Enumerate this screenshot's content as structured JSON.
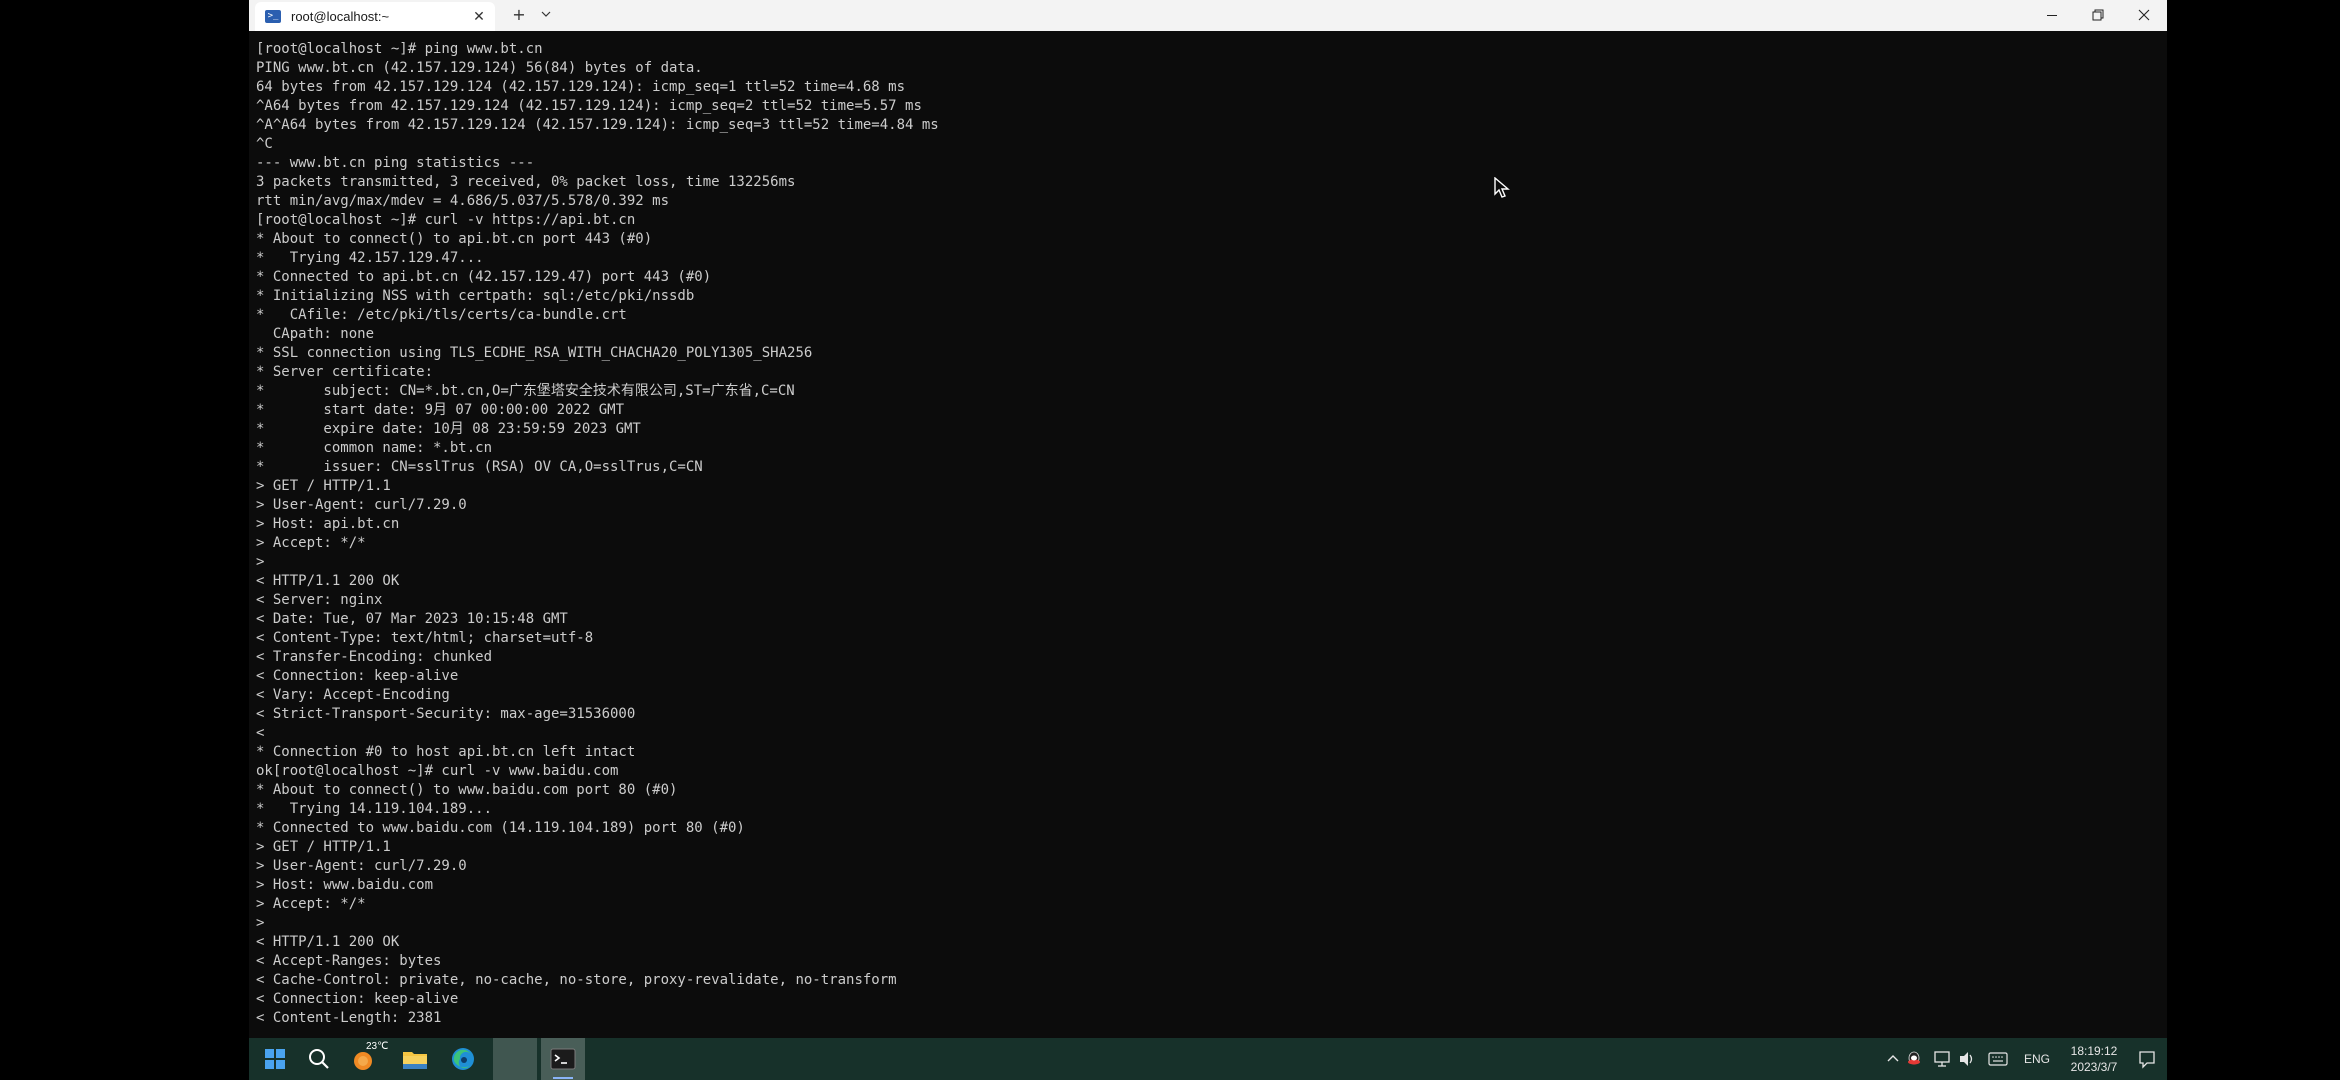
{
  "window": {
    "tab_title": "root@localhost:~",
    "tab_icon": "terminal-icon",
    "close_tab_glyph": "✕",
    "new_tab_glyph": "+",
    "dropdown_glyph": "⌄"
  },
  "terminal": {
    "lines": [
      "[root@localhost ~]# ping www.bt.cn",
      "PING www.bt.cn (42.157.129.124) 56(84) bytes of data.",
      "64 bytes from 42.157.129.124 (42.157.129.124): icmp_seq=1 ttl=52 time=4.68 ms",
      "^A64 bytes from 42.157.129.124 (42.157.129.124): icmp_seq=2 ttl=52 time=5.57 ms",
      "^A^A64 bytes from 42.157.129.124 (42.157.129.124): icmp_seq=3 ttl=52 time=4.84 ms",
      "^C",
      "--- www.bt.cn ping statistics ---",
      "3 packets transmitted, 3 received, 0% packet loss, time 132256ms",
      "rtt min/avg/max/mdev = 4.686/5.037/5.578/0.392 ms",
      "[root@localhost ~]# curl -v https://api.bt.cn",
      "* About to connect() to api.bt.cn port 443 (#0)",
      "*   Trying 42.157.129.47...",
      "* Connected to api.bt.cn (42.157.129.47) port 443 (#0)",
      "* Initializing NSS with certpath: sql:/etc/pki/nssdb",
      "*   CAfile: /etc/pki/tls/certs/ca-bundle.crt",
      "  CApath: none",
      "* SSL connection using TLS_ECDHE_RSA_WITH_CHACHA20_POLY1305_SHA256",
      "* Server certificate:",
      "*       subject: CN=*.bt.cn,O=广东堡塔安全技术有限公司,ST=广东省,C=CN",
      "*       start date: 9月 07 00:00:00 2022 GMT",
      "*       expire date: 10月 08 23:59:59 2023 GMT",
      "*       common name: *.bt.cn",
      "*       issuer: CN=sslTrus (RSA) OV CA,O=sslTrus,C=CN",
      "> GET / HTTP/1.1",
      "> User-Agent: curl/7.29.0",
      "> Host: api.bt.cn",
      "> Accept: */*",
      ">",
      "< HTTP/1.1 200 OK",
      "< Server: nginx",
      "< Date: Tue, 07 Mar 2023 10:15:48 GMT",
      "< Content-Type: text/html; charset=utf-8",
      "< Transfer-Encoding: chunked",
      "< Connection: keep-alive",
      "< Vary: Accept-Encoding",
      "< Strict-Transport-Security: max-age=31536000",
      "<",
      "* Connection #0 to host api.bt.cn left intact",
      "ok[root@localhost ~]# curl -v www.baidu.com",
      "* About to connect() to www.baidu.com port 80 (#0)",
      "*   Trying 14.119.104.189...",
      "* Connected to www.baidu.com (14.119.104.189) port 80 (#0)",
      "> GET / HTTP/1.1",
      "> User-Agent: curl/7.29.0",
      "> Host: www.baidu.com",
      "> Accept: */*",
      ">",
      "< HTTP/1.1 200 OK",
      "< Accept-Ranges: bytes",
      "< Cache-Control: private, no-cache, no-store, proxy-revalidate, no-transform",
      "< Connection: keep-alive",
      "< Content-Length: 2381"
    ]
  },
  "taskbar": {
    "weather_temp": "23℃",
    "language": "ENG",
    "clock_time": "18:19:12",
    "clock_date": "2023/3/7",
    "icons": [
      "windows-start-icon",
      "search-icon",
      "weather-icon",
      "file-explorer-icon",
      "edge-browser-icon",
      "app-window-icon",
      "terminal-icon",
      "chevron-up-icon",
      "qq-icon",
      "network-icon",
      "volume-icon",
      "keyboard-icon",
      "notification-icon"
    ]
  },
  "colors": {
    "terminal_bg": "#0c0c0c",
    "terminal_fg": "#cccccc",
    "titlebar_bg": "#f3f3f3",
    "taskbar_bg": "#17312a"
  }
}
